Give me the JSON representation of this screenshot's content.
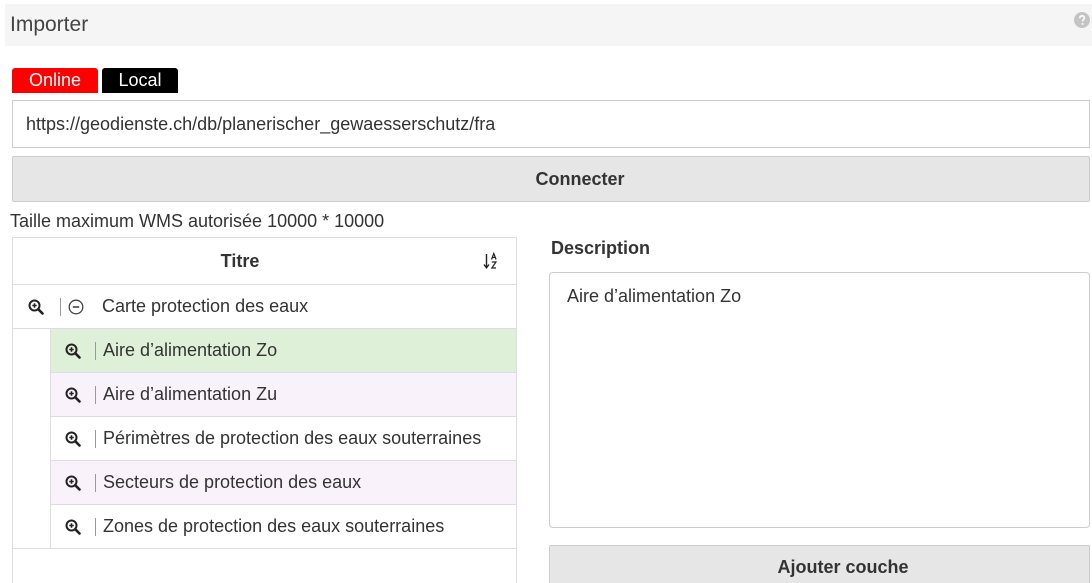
{
  "header": {
    "title": "Importer",
    "help_icon": "question-circle-icon"
  },
  "tabs": [
    {
      "label": "Online",
      "active": true
    },
    {
      "label": "Local",
      "active": false
    }
  ],
  "url_input": {
    "value": "https://geodienste.ch/db/planerischer_gewaesserschutz/fra"
  },
  "connect_button": {
    "label": "Connecter"
  },
  "max_size_text": "Taille maximum WMS autorisée 10000 * 10000",
  "layer_tree": {
    "column_title": "Titre",
    "sort_icon": "sort-alpha-down-icon",
    "root": {
      "label": "Carte protection des eaux",
      "expanded": true,
      "icons": [
        "zoom-in-icon",
        "collapse-icon"
      ]
    },
    "row_icon": "zoom-in-icon",
    "children": [
      {
        "label": "Aire d’alimentation Zo",
        "selected": true
      },
      {
        "label": "Aire d’alimentation Zu",
        "selected": false
      },
      {
        "label": "Périmètres de protection des eaux souterraines",
        "selected": false
      },
      {
        "label": "Secteurs de protection des eaux",
        "selected": false
      },
      {
        "label": "Zones de protection des eaux souterraines",
        "selected": false
      }
    ]
  },
  "description": {
    "label": "Description",
    "text": "Aire d’alimentation Zo"
  },
  "add_layer_button": {
    "label": "Ajouter couche"
  },
  "colors": {
    "online_tab": "#ff0000",
    "local_tab": "#000000",
    "selected_row": "#dff0d8",
    "striped_row": "#faf2fa"
  }
}
